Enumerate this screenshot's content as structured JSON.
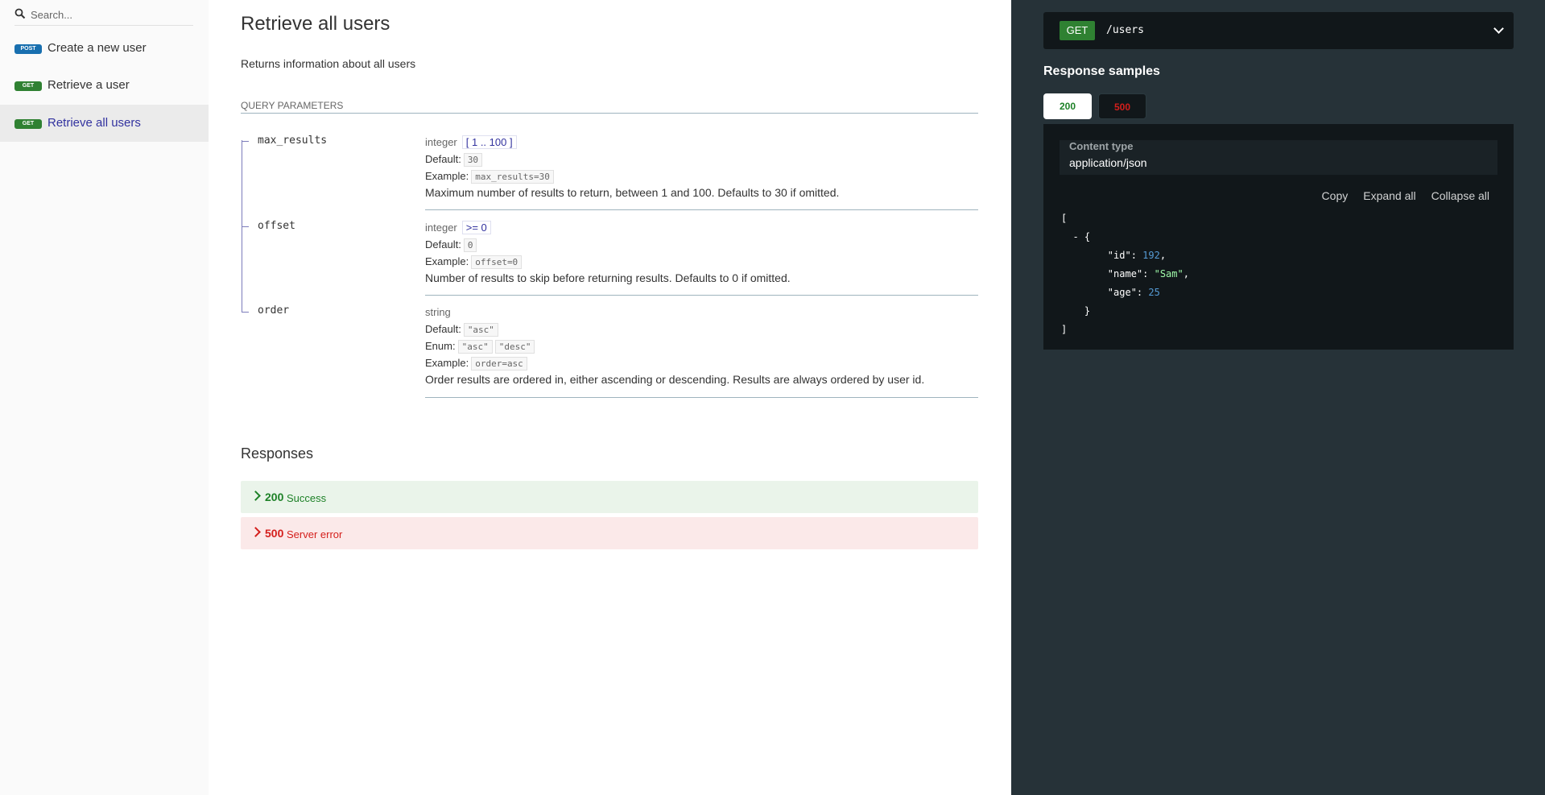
{
  "sidebar": {
    "search_placeholder": "Search...",
    "items": [
      {
        "method": "POST",
        "label": "Create a new user"
      },
      {
        "method": "GET",
        "label": "Retrieve a user"
      },
      {
        "method": "GET",
        "label": "Retrieve all users",
        "active": true
      }
    ]
  },
  "main": {
    "title": "Retrieve all users",
    "description": "Returns information about all users",
    "query_params_title": "QUERY PARAMETERS",
    "params": [
      {
        "name": "max_results",
        "type": "integer",
        "constraint": "[ 1 .. 100 ]",
        "default_label": "Default:",
        "default": "30",
        "example_label": "Example:",
        "example": "max_results=30",
        "description": "Maximum number of results to return, between 1 and 100. Defaults to 30 if omitted."
      },
      {
        "name": "offset",
        "type": "integer",
        "constraint": ">= 0",
        "default_label": "Default:",
        "default": "0",
        "example_label": "Example:",
        "example": "offset=0",
        "description": "Number of results to skip before returning results. Defaults to 0 if omitted."
      },
      {
        "name": "order",
        "type": "string",
        "default_label": "Default:",
        "default": "\"asc\"",
        "enum_label": "Enum:",
        "enum": [
          "\"asc\"",
          "\"desc\""
        ],
        "example_label": "Example:",
        "example": "order=asc",
        "description": "Order results are ordered in, either ascending or descending. Results are always ordered by user id."
      }
    ],
    "responses_title": "Responses",
    "responses": [
      {
        "code": "200",
        "text": "Success"
      },
      {
        "code": "500",
        "text": "Server error"
      }
    ]
  },
  "right": {
    "method": "GET",
    "path": "/users",
    "samples_title": "Response samples",
    "tabs": [
      "200",
      "500"
    ],
    "content_type_label": "Content type",
    "content_type": "application/json",
    "actions": [
      "Copy",
      "Expand all",
      "Collapse all"
    ],
    "json_sample": {
      "id": "192",
      "name": "\"Sam\"",
      "age": "25"
    }
  },
  "colors": {
    "post": "#186faf",
    "get": "#2f8132",
    "success": "#1d8127",
    "error": "#d41f1c",
    "active_link": "#32329f",
    "right_panel": "#263238"
  }
}
